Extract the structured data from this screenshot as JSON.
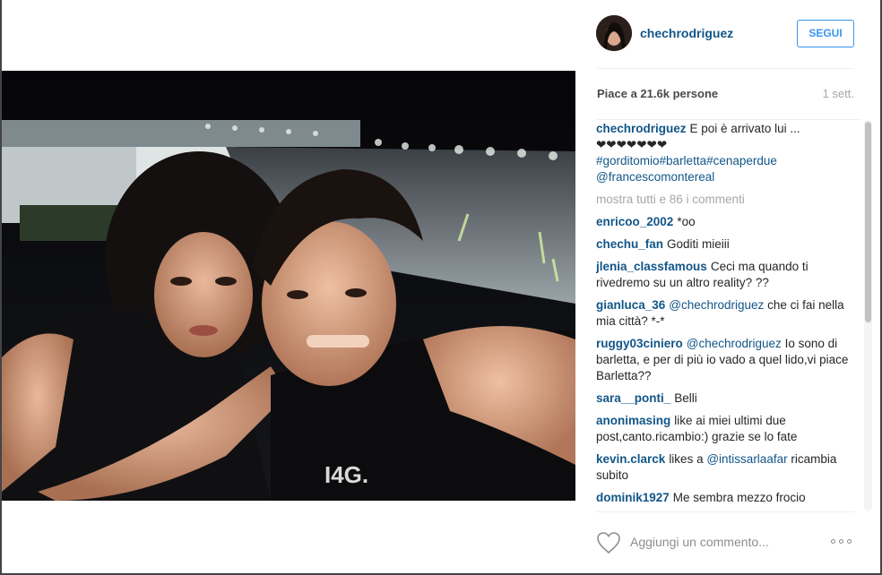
{
  "post": {
    "image_alt": "selfie"
  },
  "header": {
    "username": "chechrodriguez",
    "follow_label": "SEGUI"
  },
  "meta": {
    "likes": "Piace a 21.6k persone",
    "time": "1 sett."
  },
  "caption": {
    "user": "chechrodriguez",
    "text": "E poi è arrivato lui ...",
    "hearts": "❤❤❤❤❤❤❤",
    "tags": "#gorditomio#barletta#cenaperdue",
    "mention": "@francescomontereal"
  },
  "view_all": "mostra tutti e 86 i commenti",
  "comments": [
    {
      "user": "enricoo_2002",
      "text": "*oo"
    },
    {
      "user": "chechu_fan",
      "text": "Goditi mieiii"
    },
    {
      "user": "jlenia_classfamous",
      "text": "Ceci ma quando ti rivedremo su un altro reality? ??"
    },
    {
      "user": "gianluca_36",
      "mention": "@chechrodriguez",
      "text": "che ci fai nella mia città? *-*"
    },
    {
      "user": "ruggy03ciniero",
      "mention": "@chechrodriguez",
      "text": "Io sono di barletta, e per di più io vado a quel lido,vi piace Barletta??"
    },
    {
      "user": "sara__ponti_",
      "text": "Belli"
    },
    {
      "user": "anonimasing",
      "text": "like ai miei ultimi due post,canto.ricambio:) grazie se lo fate"
    },
    {
      "user": "kevin.clarck",
      "text": "likes a",
      "mention": "@intissarlaafar",
      "text2": "ricambia subito"
    },
    {
      "user": "dominik1927",
      "text": "Me sembra mezzo frocio"
    }
  ],
  "footer": {
    "comment_placeholder": "Aggiungi un commento..."
  },
  "icons": {
    "heart": "heart-outline-icon",
    "more": "more-options-icon"
  },
  "colors": {
    "link": "#125688",
    "follow": "#3897f0",
    "muted": "#a5a7aa"
  }
}
